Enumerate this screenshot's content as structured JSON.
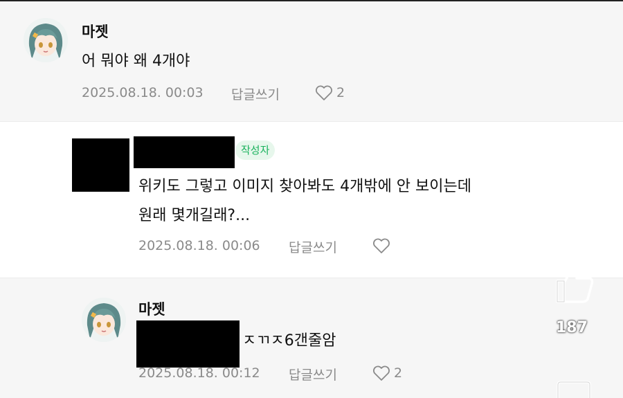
{
  "comments": [
    {
      "nickname": "마젯",
      "text": "어 뭐야 왜 4개야",
      "date": "2025.08.18. 00:03",
      "reply_label": "답글쓰기",
      "like_count": "2"
    },
    {
      "author_badge": "작성자",
      "text_line1": "위키도 그렇고 이미지 찾아봐도 4개밖에 안 보이는데",
      "text_line2": "원래 몇개길래?...",
      "date": "2025.08.18. 00:06",
      "reply_label": "답글쓰기",
      "like_count": ""
    },
    {
      "nickname": "마젯",
      "text": "ㅈㄲㅈ6갠줄암",
      "date": "2025.08.18. 00:12",
      "reply_label": "답글쓰기",
      "like_count": "2"
    }
  ],
  "floating": {
    "like_icon": "thumbs-up-icon",
    "like_count": "187"
  },
  "colors": {
    "badge_text": "#19b25c",
    "badge_bg": "#e7f7ec",
    "meta": "#8a8a8a",
    "alt_row_bg": "#f6f6f6"
  }
}
